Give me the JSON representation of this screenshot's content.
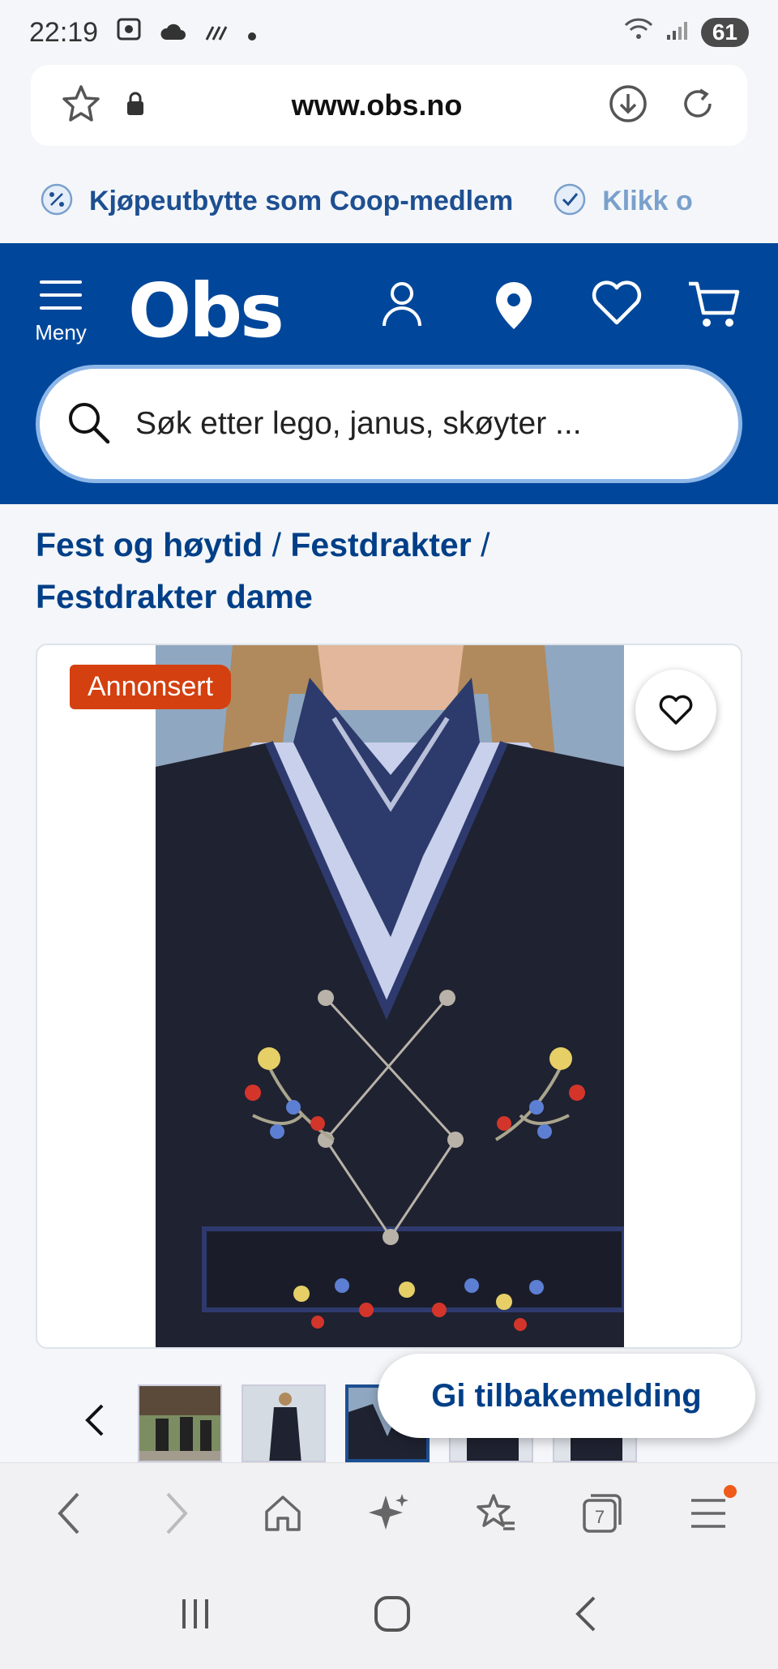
{
  "status_bar": {
    "time": "22:19",
    "battery": "61"
  },
  "url_bar": {
    "url": "www.obs.no"
  },
  "promo": {
    "items": [
      "Kjøpeutbytte som Coop-medlem",
      "Klikk o"
    ]
  },
  "header": {
    "menu_label": "Meny",
    "logo": "Obs"
  },
  "search": {
    "placeholder": "Søk etter lego, janus, skøyter ..."
  },
  "breadcrumb": {
    "items": [
      "Fest og høytid",
      "Festdrakter",
      "Festdrakter dame"
    ]
  },
  "product": {
    "ad_badge": "Annonsert"
  },
  "feedback": {
    "label": "Gi tilbakemelding"
  },
  "browser_nav": {
    "tabs_count": "7"
  },
  "colors": {
    "brand_blue": "#00479b",
    "link_blue": "#003f87",
    "ad_orange": "#d4400f"
  }
}
